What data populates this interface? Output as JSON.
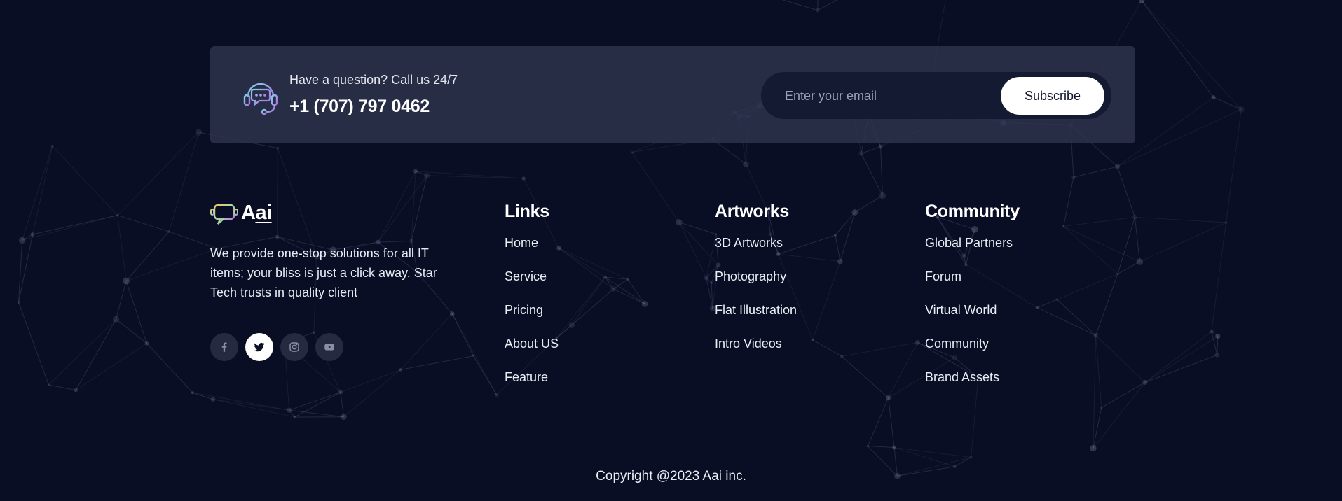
{
  "contact": {
    "question": "Have a question? Call us 24/7",
    "phone": "+1 (707) 797 0462"
  },
  "subscribe": {
    "placeholder": "Enter your email",
    "button": "Subscribe"
  },
  "brand": {
    "name_prefix": "A",
    "name_suffix": "ai",
    "description": "We provide one-stop solutions for all IT items; your bliss is just a click away. Star Tech trusts in quality client"
  },
  "socials": [
    {
      "icon": "facebook-icon",
      "active": false
    },
    {
      "icon": "twitter-icon",
      "active": true
    },
    {
      "icon": "instagram-icon",
      "active": false
    },
    {
      "icon": "youtube-icon",
      "active": false
    }
  ],
  "columns": {
    "links": {
      "title": "Links",
      "items": [
        "Home",
        "Service",
        "Pricing",
        "About US",
        "Feature"
      ]
    },
    "artworks": {
      "title": "Artworks",
      "items": [
        "3D Artworks",
        "Photography",
        "Flat Illustration",
        "Intro Videos"
      ]
    },
    "community": {
      "title": "Community",
      "items": [
        "Global Partners",
        "Forum",
        "Virtual World",
        "Community",
        "Brand Assets"
      ]
    }
  },
  "copyright": "Copyright @2023 Aai inc.",
  "colors": {
    "background": "#0a0e24",
    "bar": "#30344e",
    "input_bg": "#151a33",
    "text": "#ffffff",
    "muted": "#9aa0b5"
  }
}
